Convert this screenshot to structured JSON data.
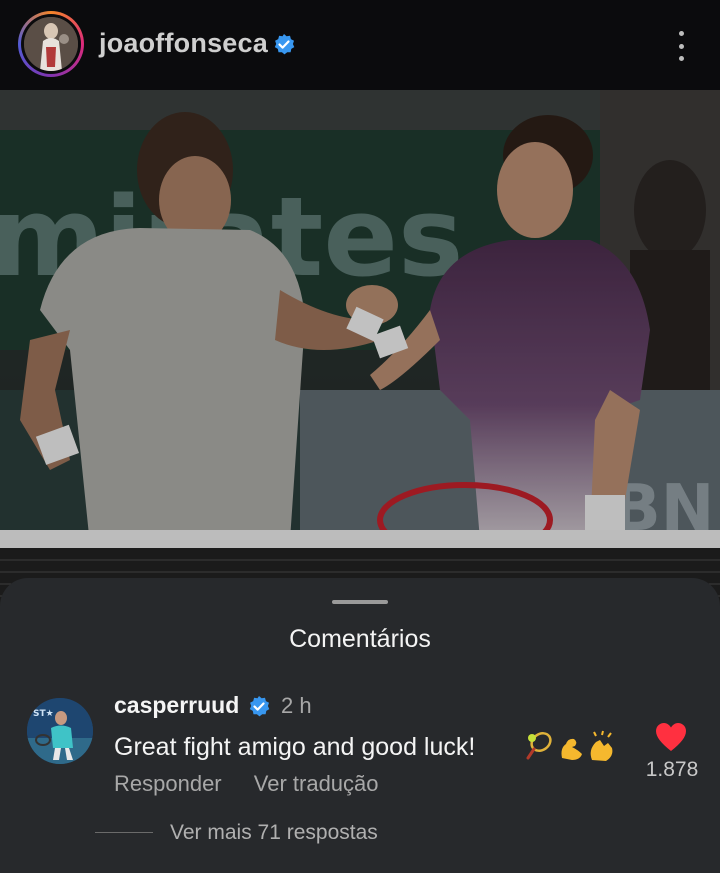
{
  "post": {
    "author": "joaoffonseca",
    "verified": true,
    "menu_icon": "more-vertical-icon"
  },
  "photo": {
    "description_icon": "post-photo"
  },
  "comments": {
    "title": "Comentários",
    "items": [
      {
        "user": "casperruud",
        "verified": true,
        "time": "2 h",
        "text": "Great fight amigo and good luck!",
        "emojis": [
          "tennis-racket-emoji",
          "flexed-biceps-emoji",
          "clapping-hands-emoji"
        ],
        "reply_label": "Responder",
        "translate_label": "Ver tradução",
        "likes": "1.878",
        "liked": true,
        "more_replies": "Ver mais 71 respostas"
      }
    ]
  },
  "colors": {
    "verified_blue": "#3897f0",
    "heart_red": "#ff3040",
    "sheet_bg": "#27292c"
  }
}
